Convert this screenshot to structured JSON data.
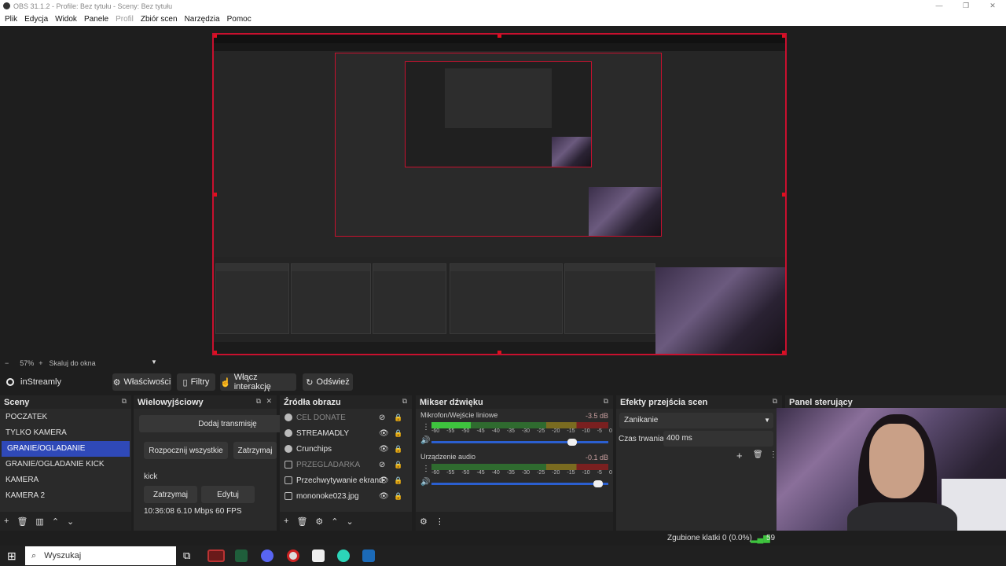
{
  "window": {
    "title": "OBS 31.1.2 - Profile: Bez tytułu - Sceny: Bez tytułu"
  },
  "menu": [
    {
      "label": "Plik",
      "disabled": false
    },
    {
      "label": "Edycja",
      "disabled": false
    },
    {
      "label": "Widok",
      "disabled": false
    },
    {
      "label": "Panele",
      "disabled": false
    },
    {
      "label": "Profil",
      "disabled": true
    },
    {
      "label": "Zbiór scen",
      "disabled": false
    },
    {
      "label": "Narzędzia",
      "disabled": false
    },
    {
      "label": "Pomoc",
      "disabled": false
    }
  ],
  "preview_footer": {
    "zoom_minus": "−",
    "zoom": "57%",
    "zoom_plus": "+",
    "scale_mode": "Skaluj do okna"
  },
  "source_toolbar": {
    "source_name": "inStreamly",
    "properties": "Właściwości",
    "filters": "Filtry",
    "interact": "Włącz interakcję",
    "refresh": "Odśwież"
  },
  "scenes": {
    "title": "Sceny",
    "items": [
      "POCZATEK",
      "TYLKO KAMERA",
      "GRANIE/OGLADANIE",
      "GRANIE/OGLADANIE KICK",
      "KAMERA",
      "KAMERA 2"
    ],
    "active_index": 2
  },
  "multistream": {
    "title": "Wielowyjściowy",
    "add_stream": "Dodaj transmisję",
    "start_all": "Rozpocznij wszystkie",
    "stop_all": "Zatrzymaj",
    "target_name": "kick",
    "stop": "Zatrzymaj",
    "edit": "Edytuj",
    "stats": "10:36:08  6.10 Mbps  60 FPS"
  },
  "sources": {
    "title": "Źródła obrazu",
    "items": [
      {
        "name": "CEL DONATE",
        "visible": false
      },
      {
        "name": "STREAMADLY",
        "visible": true
      },
      {
        "name": "Crunchips",
        "visible": true
      },
      {
        "name": "PRZEGLADARKA",
        "visible": false
      },
      {
        "name": "Przechwytywanie ekranu",
        "visible": true
      },
      {
        "name": "mononoke023.jpg",
        "visible": true
      }
    ]
  },
  "mixer": {
    "title": "Mikser dźwięku",
    "channels": [
      {
        "name": "Mikrofon/Wejście liniowe",
        "db": "-3.5 dB",
        "level": 0.22,
        "volume": 0.82
      },
      {
        "name": "Urządzenie audio",
        "db": "-0.1 dB",
        "level": 0.0,
        "volume": 0.97
      }
    ],
    "scale": [
      "-60",
      "-55",
      "-50",
      "-45",
      "-40",
      "-35",
      "-30",
      "-25",
      "-20",
      "-15",
      "-10",
      "-5",
      "0"
    ]
  },
  "transitions": {
    "title": "Efekty przejścia scen",
    "selected": "Zanikanie",
    "duration_label": "Czas trwania",
    "duration_value": "400 ms"
  },
  "control_panel": {
    "title": "Panel sterujący"
  },
  "status": {
    "dropped_frames": "Zgubione klatki 0 (0.0%)",
    "fps_partial": "59"
  },
  "taskbar": {
    "search_placeholder": "Wyszukaj"
  },
  "colors": {
    "accent": "#2f49b8",
    "preview_border": "#c8102e",
    "meter_green": "#3ec33e",
    "slider": "#2b5fd0"
  }
}
